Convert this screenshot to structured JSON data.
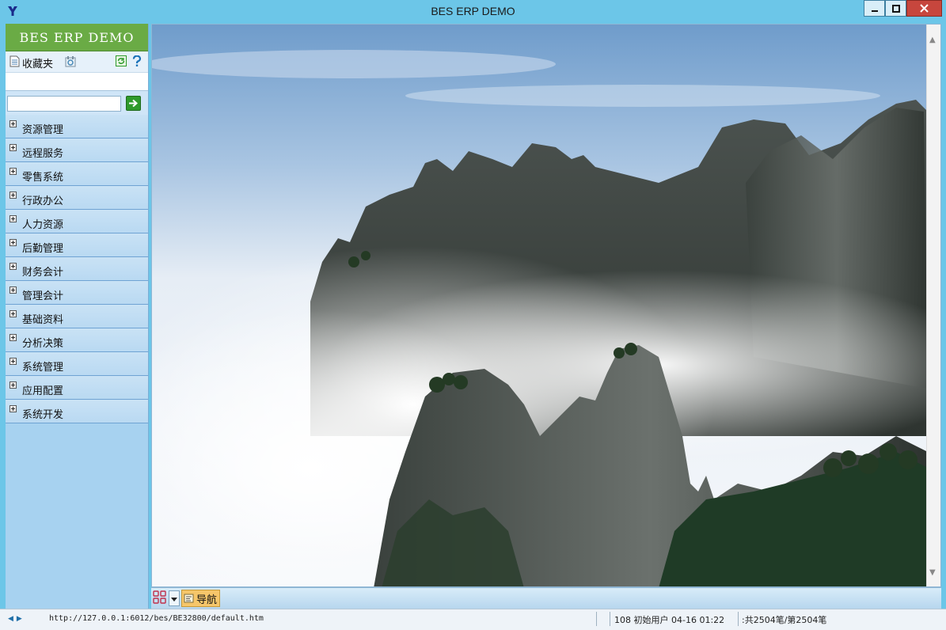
{
  "window": {
    "title": "BES ERP DEMO",
    "minimize_icon": "minimize-icon",
    "maximize_icon": "maximize-icon",
    "close_icon": "close-icon"
  },
  "sidebar": {
    "brand": "BES  ERP  DEMO",
    "favorites_label": "收藏夹",
    "search": {
      "value": "",
      "placeholder": ""
    },
    "items": [
      {
        "label": "资源管理"
      },
      {
        "label": "远程服务"
      },
      {
        "label": "零售系统"
      },
      {
        "label": "行政办公"
      },
      {
        "label": "人力资源"
      },
      {
        "label": "后勤管理"
      },
      {
        "label": "财务会计"
      },
      {
        "label": "管理会计"
      },
      {
        "label": "基础资料"
      },
      {
        "label": "分析决策"
      },
      {
        "label": "系统管理"
      },
      {
        "label": "应用配置"
      },
      {
        "label": "系统开发"
      }
    ]
  },
  "tabs": [
    {
      "label": "导航",
      "active": true
    }
  ],
  "statusbar": {
    "url": "http://127.0.0.1:6012/bes/BE32800/default.htm",
    "user_info": "108 初始用户 04-16 01:22",
    "records": ":共2504笔/第2504笔"
  },
  "colors": {
    "titlebar": "#6cc6e8",
    "brand_green": "#6aab45",
    "sidebar_bg": "#a7d2f0",
    "close_red": "#c7463d",
    "tab_active": "#f6c66a"
  }
}
